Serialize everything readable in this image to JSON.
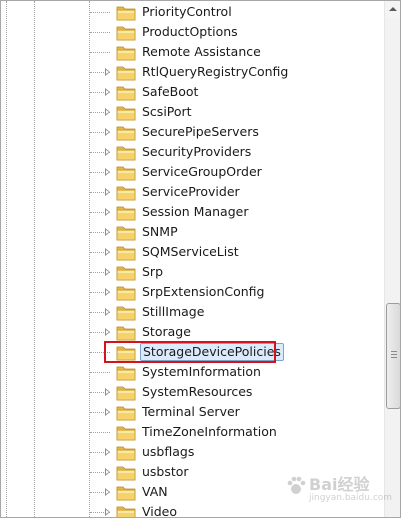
{
  "registry_tree": {
    "items": [
      {
        "label": "PriorityControl",
        "expandable": false,
        "selected": false
      },
      {
        "label": "ProductOptions",
        "expandable": false,
        "selected": false
      },
      {
        "label": "Remote Assistance",
        "expandable": false,
        "selected": false
      },
      {
        "label": "RtlQueryRegistryConfig",
        "expandable": true,
        "selected": false
      },
      {
        "label": "SafeBoot",
        "expandable": true,
        "selected": false
      },
      {
        "label": "ScsiPort",
        "expandable": true,
        "selected": false
      },
      {
        "label": "SecurePipeServers",
        "expandable": true,
        "selected": false
      },
      {
        "label": "SecurityProviders",
        "expandable": true,
        "selected": false
      },
      {
        "label": "ServiceGroupOrder",
        "expandable": true,
        "selected": false
      },
      {
        "label": "ServiceProvider",
        "expandable": true,
        "selected": false
      },
      {
        "label": "Session Manager",
        "expandable": true,
        "selected": false
      },
      {
        "label": "SNMP",
        "expandable": true,
        "selected": false
      },
      {
        "label": "SQMServiceList",
        "expandable": true,
        "selected": false
      },
      {
        "label": "Srp",
        "expandable": true,
        "selected": false
      },
      {
        "label": "SrpExtensionConfig",
        "expandable": true,
        "selected": false
      },
      {
        "label": "StillImage",
        "expandable": true,
        "selected": false
      },
      {
        "label": "Storage",
        "expandable": true,
        "selected": false
      },
      {
        "label": "StorageDevicePolicies",
        "expandable": false,
        "selected": true
      },
      {
        "label": "SystemInformation",
        "expandable": false,
        "selected": false
      },
      {
        "label": "SystemResources",
        "expandable": true,
        "selected": false
      },
      {
        "label": "Terminal Server",
        "expandable": true,
        "selected": false
      },
      {
        "label": "TimeZoneInformation",
        "expandable": false,
        "selected": false
      },
      {
        "label": "usbflags",
        "expandable": true,
        "selected": false
      },
      {
        "label": "usbstor",
        "expandable": true,
        "selected": false
      },
      {
        "label": "VAN",
        "expandable": true,
        "selected": false
      },
      {
        "label": "Video",
        "expandable": true,
        "selected": false
      }
    ],
    "icons": {
      "folder": "folder-icon",
      "expander": "expand-arrow-icon"
    }
  },
  "colors": {
    "highlight_border": "#d4141c",
    "selection_fill": "#dcebfc",
    "selection_border": "#7da2ce",
    "folder_yellow": "#f5d36a"
  },
  "watermark": {
    "text": "Bai经验",
    "sub": "jingyan.baidu.com"
  }
}
